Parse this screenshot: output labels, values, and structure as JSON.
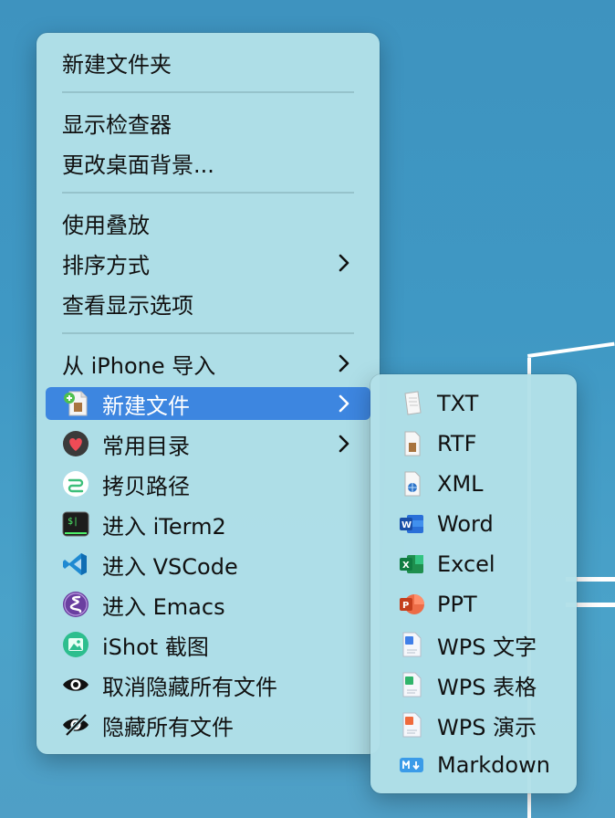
{
  "main_menu": {
    "new_folder": "新建文件夹",
    "show_inspector": "显示检查器",
    "change_background": "更改桌面背景...",
    "use_stacks": "使用叠放",
    "sort_by": "排序方式",
    "show_view_options": "查看显示选项",
    "import_from_iphone": "从 iPhone 导入",
    "new_file": "新建文件",
    "common_dirs": "常用目录",
    "copy_path": "拷贝路径",
    "open_iterm": "进入 iTerm2",
    "open_vscode": "进入 VSCode",
    "open_emacs": "进入 Emacs",
    "ishot": "iShot 截图",
    "unhide_all": "取消隐藏所有文件",
    "hide_all": "隐藏所有文件"
  },
  "sub_menu": {
    "txt": "TXT",
    "rtf": "RTF",
    "xml": "XML",
    "word": "Word",
    "excel": "Excel",
    "ppt": "PPT",
    "wps_text": "WPS 文字",
    "wps_sheet": "WPS 表格",
    "wps_show": "WPS 演示",
    "markdown": "Markdown"
  },
  "colors": {
    "highlight": "#3d86e0",
    "menu_bg": "#b2e0e8",
    "desktop": "#3f98c4"
  },
  "icons": {
    "new_file": "new-file-icon",
    "common_dirs": "heart-icon",
    "copy_path": "path-icon",
    "iterm": "iterm-icon",
    "vscode": "vscode-icon",
    "emacs": "emacs-icon",
    "ishot": "ishot-icon",
    "unhide": "eye-icon",
    "hide": "eye-slash-icon"
  }
}
